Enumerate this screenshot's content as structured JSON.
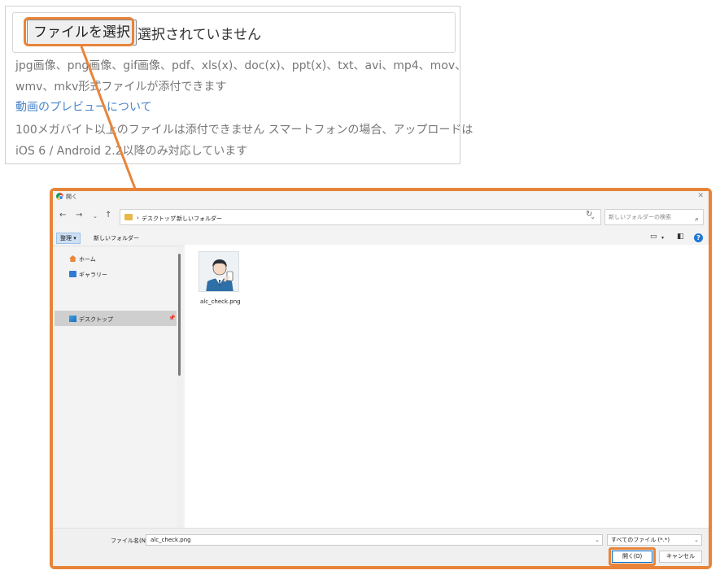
{
  "form": {
    "choose_file_label": "ファイルを選択",
    "no_file_text": "選択されていません",
    "formats_line1": "jpg画像、png画像、gif画像、pdf、xls(x)、doc(x)、ppt(x)、txt、avi、mp4、mov、",
    "formats_line2": "wmv、mkv形式ファイルが添付できます",
    "preview_link": "動画のプレビューについて",
    "limit_line1": "100メガバイト以上のファイルは添付できません スマートフォンの場合、アップロードは",
    "limit_line2": "iOS 6 / Android 2.2以降のみ対応しています"
  },
  "dialog": {
    "title": "開く",
    "breadcrumb": [
      "デスクトップ",
      "新しいフォルダー"
    ],
    "search_placeholder": "新しいフォルダーの検索",
    "organize_label": "整理 ▾",
    "new_folder_label": "新しいフォルダー",
    "nav_items": [
      {
        "label": "ホーム",
        "icon": "home-icon"
      },
      {
        "label": "ギャラリー",
        "icon": "gallery-icon"
      },
      {
        "label": "デスクトップ",
        "icon": "desktop-icon"
      }
    ],
    "file": {
      "name": "alc_check.png",
      "icon": "image-file-icon"
    },
    "filename_label": "ファイル名(N):",
    "filename_value": "alc_check.png",
    "filetype_value": "すべてのファイル (*.*)",
    "open_label": "開く(O)",
    "cancel_label": "キャンセル"
  },
  "colors": {
    "highlight": "#e8843a",
    "link": "#4a86c8",
    "accent": "#0067c0"
  }
}
